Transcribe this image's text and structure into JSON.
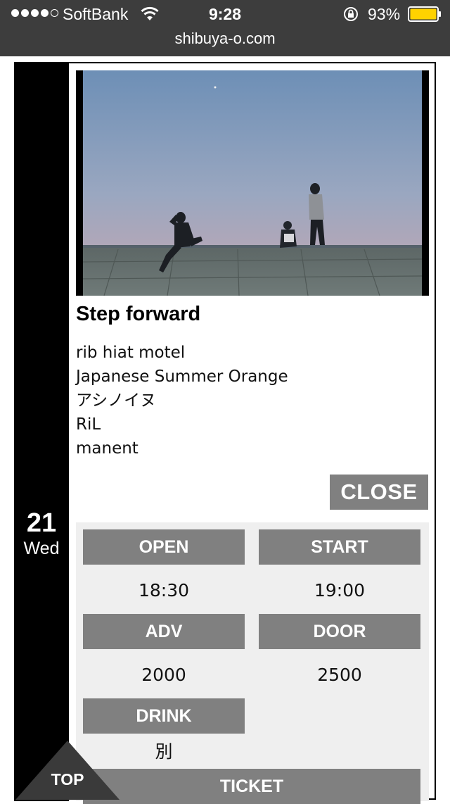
{
  "status_bar": {
    "carrier": "SoftBank",
    "time": "9:28",
    "battery_percent": "93%",
    "url": "shibuya-o.com"
  },
  "event": {
    "day": "21",
    "weekday": "Wed",
    "title": "Step forward",
    "artists": [
      "rib hiat motel",
      "Japanese Summer Orange",
      "アシノイヌ",
      "RiL",
      "manent"
    ],
    "close_label": "CLOSE",
    "info": {
      "open_label": "OPEN",
      "open_value": "18:30",
      "start_label": "START",
      "start_value": "19:00",
      "adv_label": "ADV",
      "adv_value": "2000",
      "door_label": "DOOR",
      "door_value": "2500",
      "drink_label": "DRINK",
      "drink_value": "別",
      "ticket_label": "TICKET"
    }
  },
  "top_label": "TOP",
  "colors": {
    "status_bar_bg": "#3d3d3d",
    "date_column": "#000000",
    "button_gray": "#808080",
    "panel_bg": "#efefef",
    "battery": "#ffd200"
  }
}
